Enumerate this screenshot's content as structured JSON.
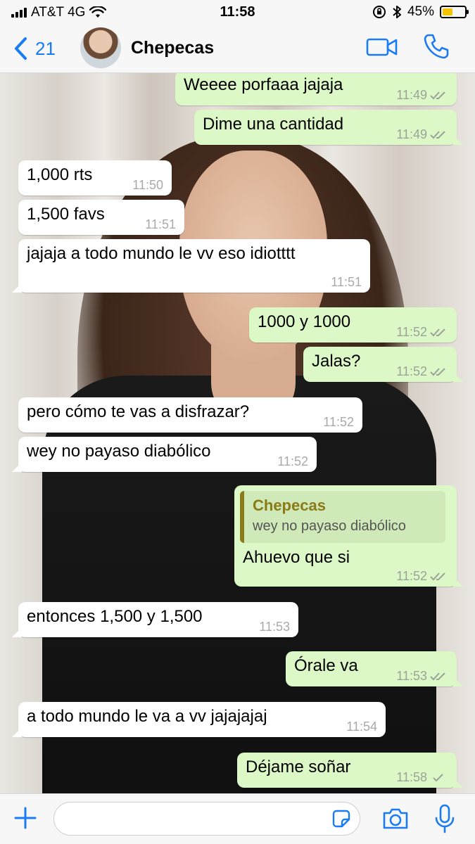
{
  "status_bar": {
    "carrier": "AT&T 4G",
    "time": "11:58",
    "battery": "45%",
    "battery_fraction": 0.45
  },
  "header": {
    "back_count": "21",
    "contact_name": "Chepecas"
  },
  "messages": [
    {
      "dir": "out",
      "text": "Weeee porfaaa jajaja",
      "time": "11:49",
      "status": "read"
    },
    {
      "dir": "out",
      "text": "Dime una cantidad",
      "time": "11:49",
      "status": "read"
    },
    {
      "dir": "in",
      "text": "1,000 rts",
      "time": "11:50"
    },
    {
      "dir": "in",
      "text": "1,500 favs",
      "time": "11:51"
    },
    {
      "dir": "in",
      "text": "jajaja a todo mundo le vv eso idiotttt",
      "time": "11:51"
    },
    {
      "dir": "out",
      "text": "1000 y 1000",
      "time": "11:52",
      "status": "read"
    },
    {
      "dir": "out",
      "text": "Jalas?",
      "time": "11:52",
      "status": "read"
    },
    {
      "dir": "in",
      "text": "pero cómo te vas a disfrazar?",
      "time": "11:52"
    },
    {
      "dir": "in",
      "text": "wey no payaso diabólico",
      "time": "11:52"
    },
    {
      "dir": "out",
      "text": "Ahuevo que si",
      "time": "11:52",
      "status": "read",
      "quote": {
        "name": "Chepecas",
        "text": "wey no payaso diabólico"
      }
    },
    {
      "dir": "in",
      "text": "entonces 1,500 y 1,500",
      "time": "11:53"
    },
    {
      "dir": "out",
      "text": "Órale va",
      "time": "11:53",
      "status": "read"
    },
    {
      "dir": "in",
      "text": "a todo mundo le va a vv jajajajaj",
      "time": "11:54"
    },
    {
      "dir": "out",
      "text": "Déjame soñar",
      "time": "11:58",
      "status": "sent"
    }
  ],
  "colors": {
    "accent": "#1a7cf5",
    "outgoing": "#dcf8c6",
    "incoming": "#ffffff",
    "quote_author": "#8a7a18"
  },
  "icons": {
    "back": "chevron-left-icon",
    "video": "video-camera-icon",
    "call": "phone-icon",
    "plus": "plus-icon",
    "sticker": "sticker-icon",
    "camera": "camera-icon",
    "mic": "microphone-icon"
  }
}
